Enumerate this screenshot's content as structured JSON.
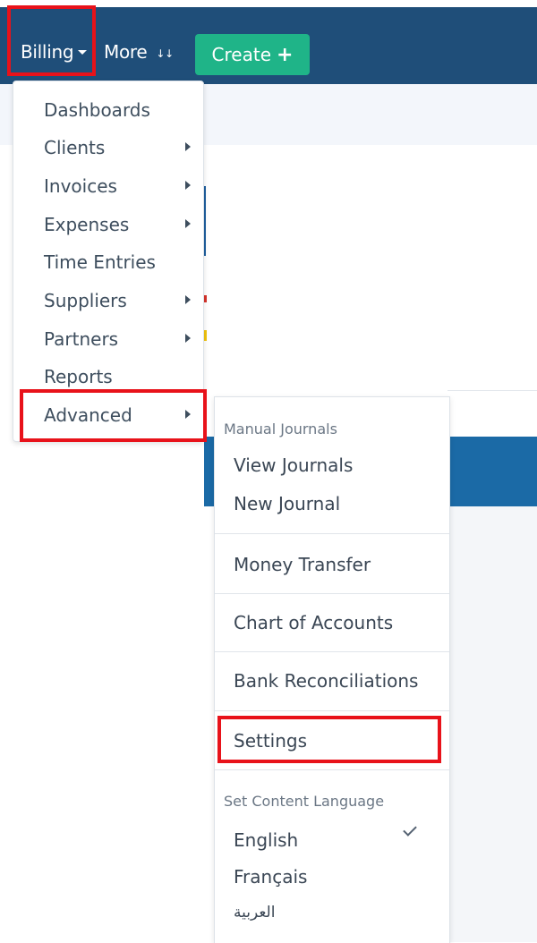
{
  "navbar": {
    "billing_label": "Billing",
    "more_label": "More",
    "more_icon": "double-chevron-down-icon",
    "create_label": "Create",
    "create_icon": "plus-icon",
    "bg_color": "#1f4e79",
    "create_color": "#1fb488"
  },
  "billing_menu": {
    "items": [
      {
        "label": "Dashboards",
        "has_submenu": false
      },
      {
        "label": "Clients",
        "has_submenu": true
      },
      {
        "label": "Invoices",
        "has_submenu": true
      },
      {
        "label": "Expenses",
        "has_submenu": true
      },
      {
        "label": "Time Entries",
        "has_submenu": false
      },
      {
        "label": "Suppliers",
        "has_submenu": true
      },
      {
        "label": "Partners",
        "has_submenu": true
      },
      {
        "label": "Reports",
        "has_submenu": false
      },
      {
        "label": "Advanced",
        "has_submenu": true
      }
    ]
  },
  "advanced_menu": {
    "manual_journals_header": "Manual Journals",
    "view_journals": "View Journals",
    "new_journal": "New Journal",
    "money_transfer": "Money Transfer",
    "chart_of_accounts": "Chart of Accounts",
    "bank_reconciliations": "Bank Reconciliations",
    "settings": "Settings",
    "language_header": "Set Content Language",
    "languages": [
      {
        "label": "English",
        "selected": true
      },
      {
        "label": "Français",
        "selected": false
      },
      {
        "label": "العربية",
        "selected": false
      }
    ]
  },
  "highlight_color": "#e8121a"
}
